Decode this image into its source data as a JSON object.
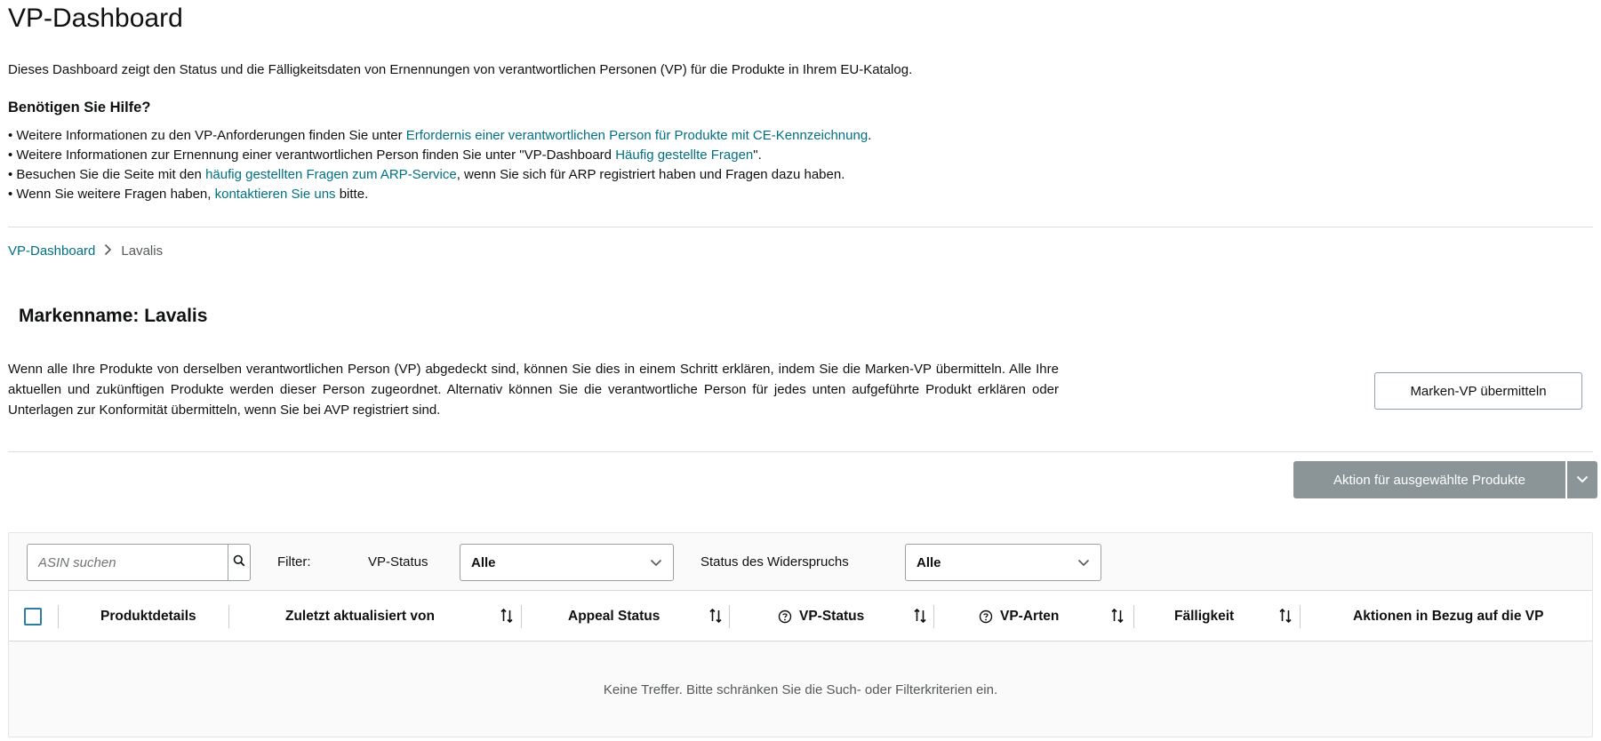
{
  "header": {
    "title": "VP-Dashboard",
    "intro": "Dieses Dashboard zeigt den Status und die Fälligkeitsdaten von Ernennungen von verantwortlichen Personen (VP) für die Produkte in Ihrem EU-Katalog."
  },
  "help": {
    "heading": "Benötigen Sie Hilfe?",
    "line1": {
      "pre": "• Weitere Informationen zu den VP-Anforderungen finden Sie unter ",
      "link": "Erfordernis einer verantwortlichen Person für Produkte mit CE-Kennzeichnung",
      "post": "."
    },
    "line2": {
      "pre": "• Weitere Informationen zur Ernennung einer verantwortlichen Person finden Sie unter \"VP-Dashboard ",
      "link": "Häufig gestellte Fragen",
      "post": "\"."
    },
    "line3": {
      "pre": "• Besuchen Sie die Seite mit den ",
      "link": "häufig gestellten Fragen zum ARP-Service",
      "post": ", wenn Sie sich für ARP registriert haben und Fragen dazu haben."
    },
    "line4": {
      "pre": "• Wenn Sie weitere Fragen haben, ",
      "link": "kontaktieren Sie uns",
      "post": " bitte."
    }
  },
  "breadcrumb": {
    "root": "VP-Dashboard",
    "separator": ">",
    "current": "Lavalis"
  },
  "brand": {
    "title": "Markenname: Lavalis",
    "description": "Wenn alle Ihre Produkte von derselben verantwortlichen Person (VP) abgedeckt sind, können Sie dies in einem Schritt erklären, indem Sie die Marken-VP übermitteln. Alle Ihre aktuellen und zukünftigen Produkte werden dieser Person zugeordnet. Alternativ können Sie die verantwortliche Person für jedes unten aufgeführte Produkt erklären oder Unterlagen zur Konformität übermitteln, wenn Sie bei AVP registriert sind.",
    "submit_button": "Marken-VP übermitteln"
  },
  "actions": {
    "bulk_action_button": "Aktion für ausgewählte Produkte"
  },
  "filters": {
    "search_placeholder": "ASIN suchen",
    "filter_label": "Filter:",
    "vp_status_label": "VP-Status",
    "vp_status_value": "Alle",
    "appeal_label": "Status des Widerspruchs",
    "appeal_value": "Alle"
  },
  "table": {
    "columns": {
      "product_details": "Produktdetails",
      "last_updated": "Zuletzt aktualisiert von",
      "appeal_status": "Appeal Status",
      "vp_status": "VP-Status",
      "vp_types": "VP-Arten",
      "due": "Fälligkeit",
      "actions": "Aktionen in Bezug auf die VP"
    },
    "empty_message": "Keine Treffer. Bitte schränken Sie die Such- oder Filterkriterien ein."
  },
  "colors": {
    "link": "#007185",
    "disabled_button": "#8b9597",
    "checkbox_border": "#2e7da3"
  },
  "icons": [
    "search-icon",
    "chevron-down-icon",
    "sort-icon",
    "help-circle-icon",
    "breadcrumb-chevron-icon"
  ]
}
